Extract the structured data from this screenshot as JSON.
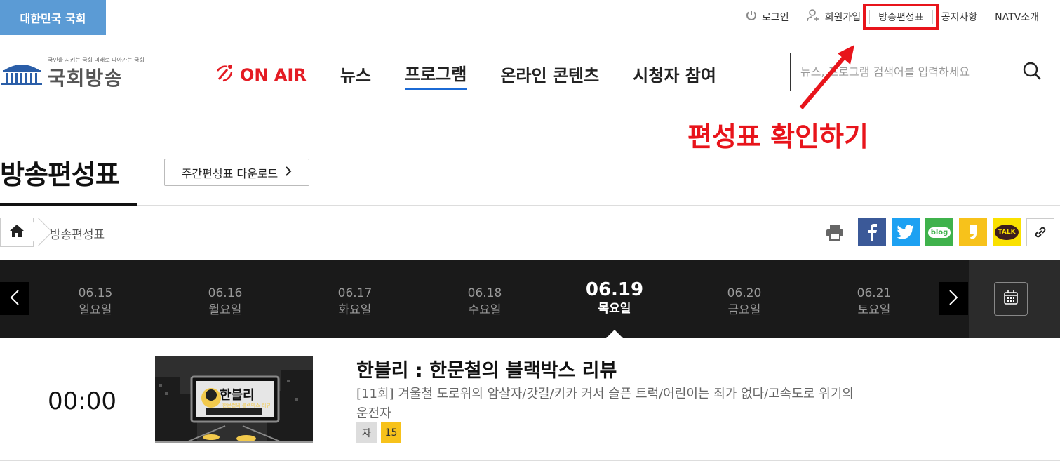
{
  "top_bar": {
    "assembly_label": "대한민국 국회",
    "util_links": {
      "login": "로그인",
      "signup": "회원가입",
      "schedule": "방송편성표",
      "notice": "공지사항",
      "about": "NATV소개"
    }
  },
  "logo": {
    "tagline": "국민을 지키는 국회 미래로 나아가는 국회",
    "name": "국회방송"
  },
  "gnb": {
    "onair": "ON AIR",
    "items": [
      "뉴스",
      "프로그램",
      "온라인 콘텐츠",
      "시청자 참여"
    ],
    "active_index": 1
  },
  "search": {
    "placeholder": "뉴스, 프로그램 검색어를 입력하세요"
  },
  "annotation": {
    "text": "편성표 확인하기",
    "color": "#e8141b"
  },
  "page": {
    "title": "방송편성표",
    "download_label": "주간편성표 다운로드"
  },
  "breadcrumb": {
    "current": "방송편성표"
  },
  "share": {
    "icons": [
      "print-icon",
      "facebook-icon",
      "twitter-icon",
      "blog-icon",
      "story-icon",
      "talk-icon",
      "link-icon"
    ],
    "blog_label": "blog",
    "talk_label": "TALK",
    "colors": {
      "facebook": "#3b5998",
      "twitter": "#1da1f2",
      "blog": "#3fb24c",
      "story": "#f7c21b",
      "talk": "#fae100"
    }
  },
  "dates": [
    {
      "date": "06.15",
      "weekday": "일요일"
    },
    {
      "date": "06.16",
      "weekday": "월요일"
    },
    {
      "date": "06.17",
      "weekday": "화요일"
    },
    {
      "date": "06.18",
      "weekday": "수요일"
    },
    {
      "date": "06.19",
      "weekday": "목요일",
      "selected": true
    },
    {
      "date": "06.20",
      "weekday": "금요일"
    },
    {
      "date": "06.21",
      "weekday": "토요일"
    }
  ],
  "program": {
    "time": "00:00",
    "title": "한블리 : 한문철의 블랙박스 리뷰",
    "description": "[11회] 겨울철 도로위의 암살자/갓길/키카 커서 슬픈 트럭/어린이는 죄가 없다/고속도로 위기의 운전자",
    "thumb_title": "한블리",
    "thumb_sub": "한문철의 블랙박스 리뷰",
    "badges": {
      "subtitle": "자",
      "age": "15"
    }
  }
}
